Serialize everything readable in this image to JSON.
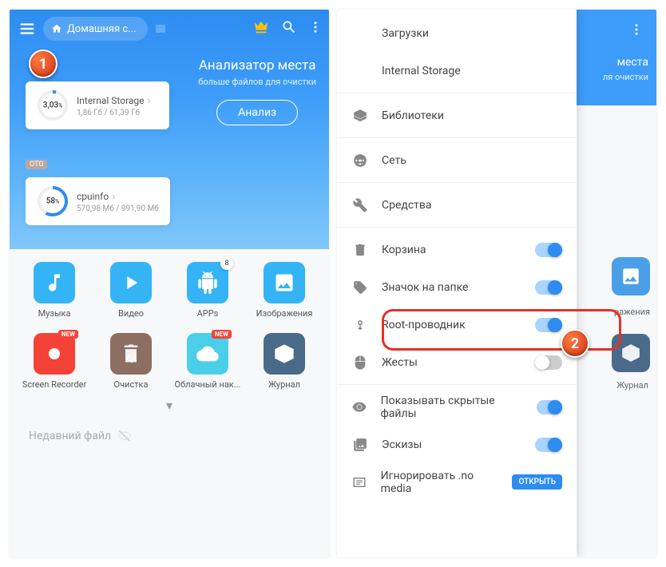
{
  "left": {
    "breadcrumb": "Домашняя с...",
    "analyzer": {
      "title": "Анализатор места",
      "sub": "больше файлов для очистки",
      "button": "Анализ"
    },
    "storages": [
      {
        "pct": "3,03",
        "name": "Internal Storage",
        "size": "1,86 Гб / 61,39 Гб"
      },
      {
        "pct": "58",
        "name": "cpuinfo",
        "size": "570,98 Мб / 991,90 Мб"
      }
    ],
    "otg": "OTG",
    "grid": [
      {
        "label": "Музыка",
        "color": "#34b4f4",
        "badge": ""
      },
      {
        "label": "Видео",
        "color": "#34b4f4",
        "badge": ""
      },
      {
        "label": "APPs",
        "color": "#34b4f4",
        "badge": "8"
      },
      {
        "label": "Изображения",
        "color": "#34b4f4",
        "badge": ""
      },
      {
        "label": "Screen Recorder",
        "color": "#f44336",
        "badge": "NEW"
      },
      {
        "label": "Очистка",
        "color": "#8d6e63",
        "badge": ""
      },
      {
        "label": "Облачный нак...",
        "color": "#4bcfe8",
        "badge": "NEW"
      },
      {
        "label": "Журнал",
        "color": "#4a6a8a",
        "badge": ""
      }
    ],
    "recent": "Недавний файл"
  },
  "right": {
    "bg": {
      "title": "места",
      "sub": "ля очистки",
      "ilabel1": "ражения",
      "ilabel2": "Журнал"
    },
    "items": [
      {
        "icon": "",
        "label": "Загрузки",
        "type": "link"
      },
      {
        "icon": "",
        "label": "Internal Storage",
        "type": "link"
      },
      {
        "type": "divider"
      },
      {
        "icon": "layers",
        "label": "Библиотеки",
        "type": "link"
      },
      {
        "type": "divider"
      },
      {
        "icon": "network",
        "label": "Сеть",
        "type": "link"
      },
      {
        "type": "divider"
      },
      {
        "icon": "wrench",
        "label": "Средства",
        "type": "link"
      },
      {
        "type": "divider"
      },
      {
        "icon": "trash",
        "label": "Корзина",
        "type": "toggle",
        "on": true
      },
      {
        "icon": "tag",
        "label": "Значок на папке",
        "type": "toggle",
        "on": true
      },
      {
        "icon": "root",
        "label": "Root-проводник",
        "type": "toggle",
        "on": true
      },
      {
        "icon": "gesture",
        "label": "Жесты",
        "type": "toggle",
        "on": false
      },
      {
        "type": "divider"
      },
      {
        "icon": "eye",
        "label": "Показывать скрытые файлы",
        "type": "toggle",
        "on": true
      },
      {
        "icon": "thumb",
        "label": "Эскизы",
        "type": "toggle",
        "on": true
      },
      {
        "icon": "nomedia",
        "label": "Игнорировать .no media",
        "type": "button",
        "btn": "ОТКРЫТЬ"
      }
    ]
  },
  "markers": {
    "m1": "1",
    "m2": "2"
  }
}
